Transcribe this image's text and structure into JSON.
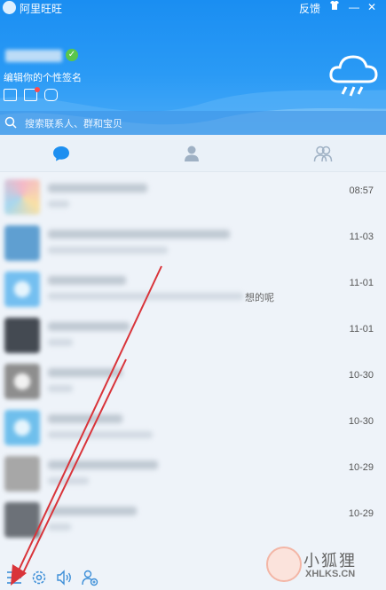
{
  "window": {
    "title": "阿里旺旺",
    "feedback_label": "反馈",
    "skin_icon": "shirt-icon",
    "minimize_label": "—",
    "close_label": "✕"
  },
  "profile": {
    "signature": "编辑你的个性签名",
    "verified_icon": "check-badge-icon",
    "icons": [
      "card-icon",
      "notice-icon",
      "bag-icon"
    ]
  },
  "search": {
    "placeholder": "搜索联系人、群和宝贝"
  },
  "tabs": [
    "recent-chats-icon",
    "contacts-icon",
    "groups-icon"
  ],
  "conversations": [
    {
      "time": "08:57",
      "avatar_color": "#e9a7b9"
    },
    {
      "time": "11-03",
      "avatar_color": "#5f9fd1"
    },
    {
      "time": "11-01",
      "avatar_color": "#74bff0",
      "msg_tail": "想的呢"
    },
    {
      "time": "11-01",
      "avatar_color": "#444a52"
    },
    {
      "time": "10-30",
      "avatar_color": "#8e8e8e"
    },
    {
      "time": "10-30",
      "avatar_color": "#6fbfec"
    },
    {
      "time": "10-29",
      "avatar_color": "#a7a7a7"
    },
    {
      "time": "10-29",
      "avatar_color": "#6c7178"
    }
  ],
  "bottom_bar": [
    "menu-icon",
    "settings-icon",
    "sound-icon",
    "add-contact-icon"
  ],
  "watermark": {
    "title": "小狐狸",
    "url": "XHLKS.CN"
  },
  "colors": {
    "accent": "#1a8ef2",
    "arrow": "#d9343a",
    "verified": "#5ac64b"
  }
}
